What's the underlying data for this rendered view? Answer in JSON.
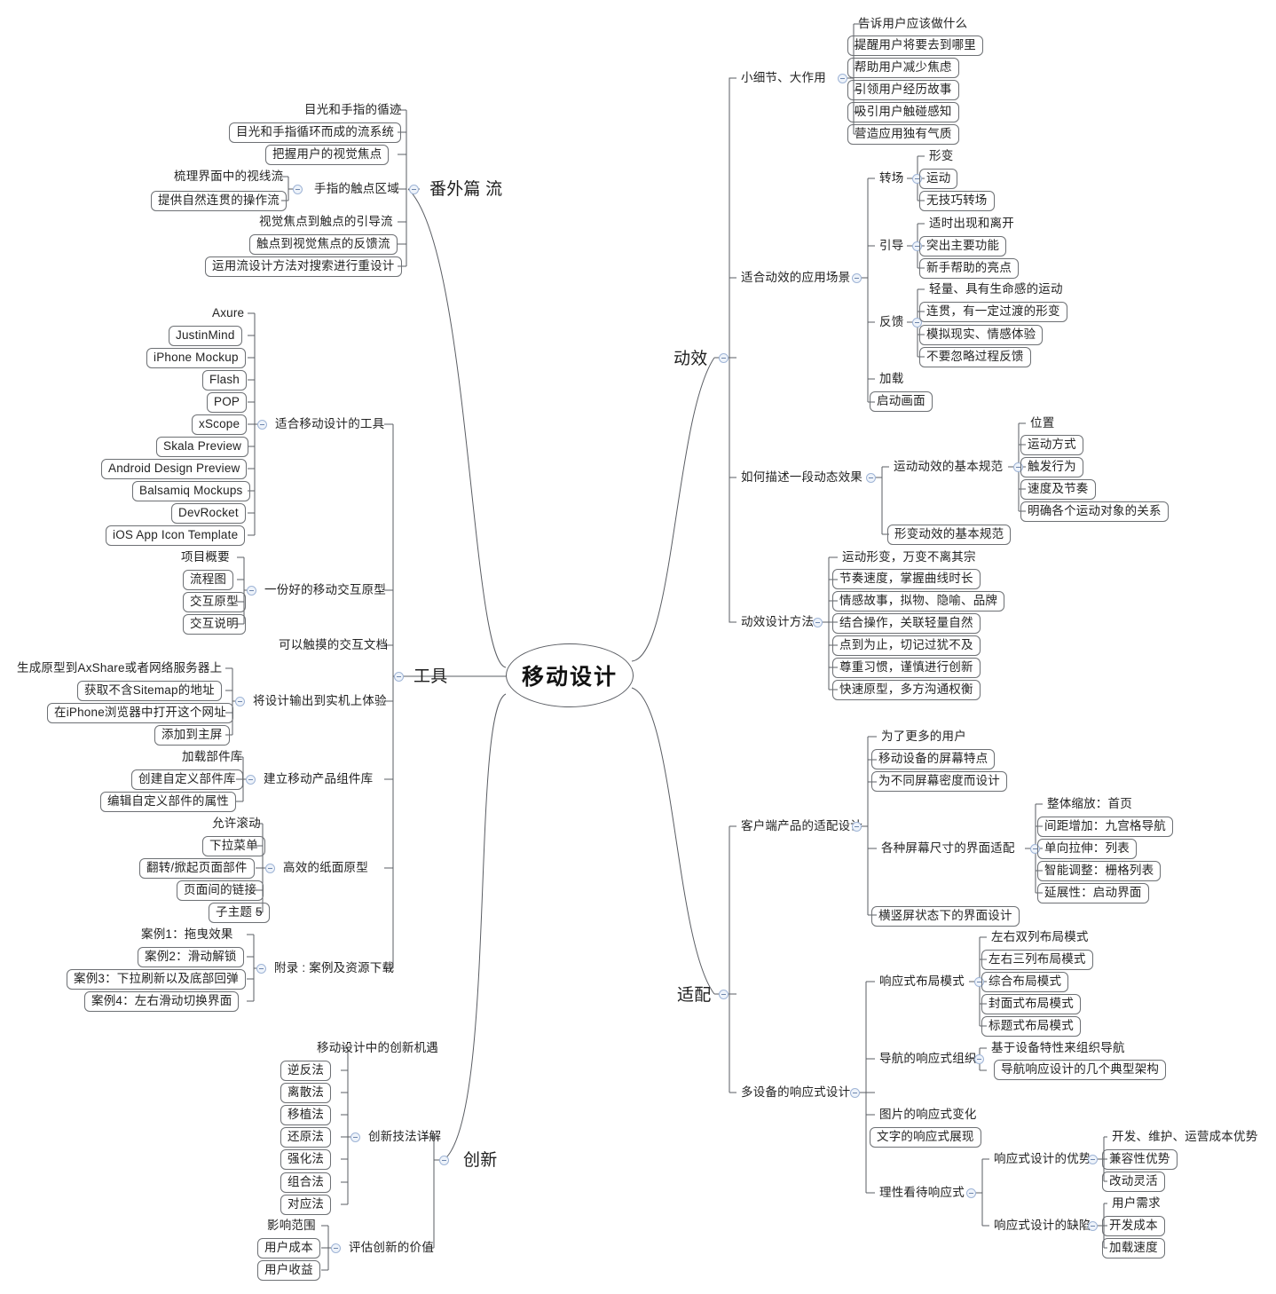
{
  "root": {
    "label": "移动设计"
  },
  "icons": {
    "collapse": "collapse-minus-icon"
  },
  "colors": {
    "line": "#5a5d63",
    "box_border": "#6d7074",
    "text": "#232323",
    "knob_border": "#9fb4d6",
    "knob_fill": "#eef3fa"
  },
  "branches": {
    "dongxiao": {
      "label": "动效",
      "children": {
        "xiaoxijie": {
          "label": "小细节、大作用",
          "items": [
            "告诉用户应该做什么",
            "提醒用户将要去到哪里",
            "帮助用户减少焦虑",
            "引领用户经历故事",
            "吸引用户触碰感知",
            "营造应用独有气质"
          ]
        },
        "changjing": {
          "label": "适合动效的应用场景",
          "zhuanchang": {
            "label": "转场",
            "items": [
              "形变",
              "运动",
              "无技巧转场"
            ]
          },
          "yindao": {
            "label": "引导",
            "items": [
              "适时出现和离开",
              "突出主要功能",
              "新手帮助的亮点"
            ]
          },
          "fankui": {
            "label": "反馈",
            "items": [
              "轻量、具有生命感的运动",
              "连贯，有一定过渡的形变",
              "模拟现实、情感体验",
              "不要忽略过程反馈"
            ]
          },
          "tail": [
            "加载",
            "启动画面"
          ]
        },
        "miaoshu": {
          "label": "如何描述一段动态效果",
          "yundong": {
            "label": "运动动效的基本规范",
            "items": [
              "位置",
              "运动方式",
              "触发行为",
              "速度及节奏",
              "明确各个运动对象的关系"
            ]
          },
          "xingbian": {
            "label": "形变动效的基本规范"
          }
        },
        "fangfa": {
          "label": "动效设计方法",
          "items": [
            "运动形变，万变不离其宗",
            "节奏速度，掌握曲线时长",
            "情感故事，拟物、隐喻、品牌",
            "结合操作，关联轻量自然",
            "点到为止，切记过犹不及",
            "尊重习惯，谨慎进行创新",
            "快速原型，多方沟通权衡"
          ]
        }
      }
    },
    "shipei": {
      "label": "适配",
      "children": {
        "kehuduan": {
          "label": "客户端产品的适配设计",
          "top": [
            "为了更多的用户",
            "移动设备的屏幕特点",
            "为不同屏幕密度而设计"
          ],
          "gezhong": {
            "label": "各种屏幕尺寸的界面适配",
            "items": [
              "整体缩放：首页",
              "间距增加：九宫格导航",
              "单向拉伸：列表",
              "智能调整：栅格列表",
              "延展性：启动界面"
            ]
          },
          "hengshu": {
            "label": "横竖屏状态下的界面设计"
          }
        },
        "duoshebei": {
          "label": "多设备的响应式设计",
          "buju": {
            "label": "响应式布局模式",
            "items": [
              "左右双列布局模式",
              "左右三列布局模式",
              "综合布局模式",
              "封面式布局模式",
              "标题式布局模式"
            ]
          },
          "daohang": {
            "label": "导航的响应式组织",
            "items": [
              "基于设备特性来组织导航",
              "导航响应设计的几个典型架构"
            ]
          },
          "tail": [
            "图片的响应式变化",
            "文字的响应式展现"
          ],
          "lixing": {
            "label": "理性看待响应式",
            "youshi": {
              "label": "响应式设计的优势",
              "items": [
                "开发、维护、运营成本优势",
                "兼容性优势",
                "改动灵活"
              ]
            },
            "quexian": {
              "label": "响应式设计的缺陷",
              "items": [
                "用户需求",
                "开发成本",
                "加载速度"
              ]
            }
          }
        }
      }
    },
    "fanwai": {
      "label": "番外篇 流",
      "items_top": [
        "目光和手指的循迹",
        "目光和手指循环而成的流系统",
        "把握用户的视觉焦点"
      ],
      "chudian": {
        "label": "手指的触点区域",
        "items": [
          "梳理界面中的视线流",
          "提供自然连贯的操作流"
        ]
      },
      "items_bottom": [
        "视觉焦点到触点的引导流",
        "触点到视觉焦点的反馈流",
        "运用流设计方法对搜索进行重设计"
      ]
    },
    "gongju": {
      "label": "工具",
      "children": {
        "yidonggongju": {
          "label": "适合移动设计的工具",
          "items": [
            "Axure",
            "JustinMind",
            "iPhone Mockup",
            "Flash",
            "POP",
            "xScope",
            "Skala Preview",
            "Android Design Preview",
            "Balsamiq Mockups",
            "DevRocket",
            "iOS App Icon Template"
          ]
        },
        "yuanxing": {
          "label": "一份好的移动交互原型",
          "items": [
            "项目概要",
            "流程图",
            "交互原型",
            "交互说明"
          ]
        },
        "wendang": {
          "label": "可以触摸的交互文档"
        },
        "shuchu": {
          "label": "将设计输出到实机上体验",
          "items": [
            "生成原型到AxShare或者网络服务器上",
            "获取不含Sitemap的地址",
            "在iPhone浏览器中打开这个网址",
            "添加到主屏"
          ]
        },
        "zujianku": {
          "label": "建立移动产品组件库",
          "items": [
            "加载部件库",
            "创建自定义部件库",
            "编辑自定义部件的属性"
          ]
        },
        "zhimian": {
          "label": "高效的纸面原型",
          "items": [
            "允许滚动",
            "下拉菜单",
            "翻转/掀起页面部件",
            "页面间的链接",
            "子主题 5"
          ]
        },
        "fulu": {
          "label": "附录 : 案例及资源下载",
          "items": [
            "案例1：拖曳效果",
            "案例2：滑动解锁",
            "案例3：下拉刷新以及底部回弹",
            "案例4：左右滑动切换界面"
          ]
        }
      }
    },
    "chuangxin": {
      "label": "创新",
      "children": {
        "jifa": {
          "label": "创新技法详解",
          "items": [
            "移动设计中的创新机遇",
            "逆反法",
            "离散法",
            "移植法",
            "还原法",
            "强化法",
            "组合法",
            "对应法"
          ]
        },
        "pinggu": {
          "label": "评估创新的价值",
          "items": [
            "影响范围",
            "用户成本",
            "用户收益"
          ]
        }
      }
    }
  }
}
